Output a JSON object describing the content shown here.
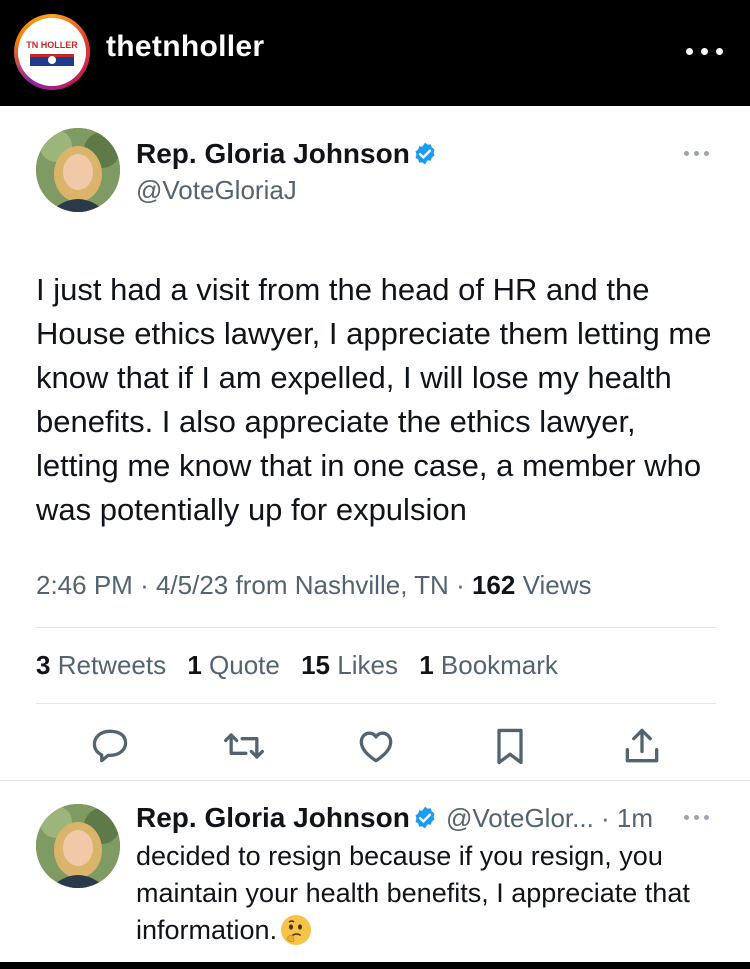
{
  "instagram": {
    "account_name": "thetnholler",
    "logo_text": "TN HOLLER"
  },
  "tweet": {
    "author_name": "Rep. Gloria Johnson",
    "handle": "@VoteGloriaJ",
    "text": "I just had a visit from the head of HR and the House ethics lawyer, I appreciate them letting me know that if I am expelled, I will lose my health benefits. I also appreciate the ethics lawyer, letting me know that in one case, a member who was potentially up for expulsion",
    "time": "2:46 PM",
    "date": "4/5/23",
    "location": "from Nashville, TN",
    "views_count": "162",
    "views_label": "Views",
    "stats": {
      "retweets_count": "3",
      "retweets_label": "Retweets",
      "quotes_count": "1",
      "quotes_label": "Quote",
      "likes_count": "15",
      "likes_label": "Likes",
      "bookmarks_count": "1",
      "bookmarks_label": "Bookmark"
    }
  },
  "reply": {
    "author_name": "Rep. Gloria Johnson",
    "handle": "@VoteGlor...",
    "age": "· 1m",
    "text": "decided to resign because if you resign, you maintain your health benefits, I appreciate that information."
  },
  "colors": {
    "verified_blue": "#1d9bf0",
    "secondary_text": "#536471",
    "icon_color": "#536471"
  },
  "icons": [
    "more-icon",
    "verified-badge-icon",
    "reply-icon",
    "retweet-icon",
    "like-icon",
    "bookmark-icon",
    "share-icon",
    "thinking-face-emoji"
  ]
}
